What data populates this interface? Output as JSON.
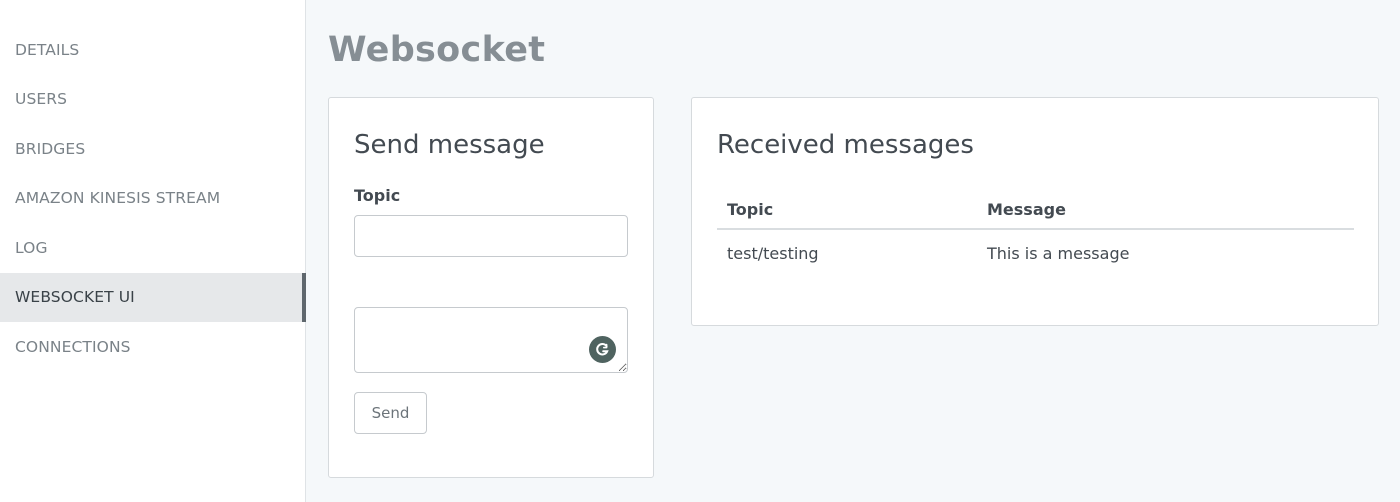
{
  "sidebar": {
    "items": [
      {
        "label": "DETAILS"
      },
      {
        "label": "USERS"
      },
      {
        "label": "BRIDGES"
      },
      {
        "label": "AMAZON KINESIS STREAM"
      },
      {
        "label": "LOG"
      },
      {
        "label": "WEBSOCKET UI",
        "active": true
      },
      {
        "label": "CONNECTIONS"
      }
    ]
  },
  "page": {
    "title": "Websocket"
  },
  "send": {
    "title": "Send message",
    "topic_label": "Topic",
    "topic_value": "",
    "message_value": "",
    "send_label": "Send",
    "grammarly_icon": "grammarly-icon"
  },
  "received": {
    "title": "Received messages",
    "columns": [
      "Topic",
      "Message"
    ],
    "rows": [
      {
        "topic": "test/testing",
        "message": "This is a message"
      }
    ]
  },
  "colors": {
    "accent_bar": "#5f676d",
    "grammarly": "#4f6360",
    "background": "#f5f8fa"
  }
}
